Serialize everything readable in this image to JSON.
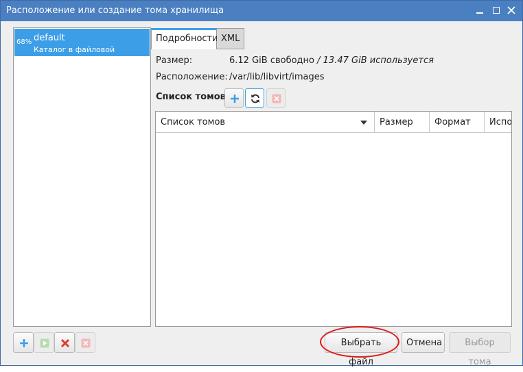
{
  "window": {
    "title": "Расположение или создание тома хранилища"
  },
  "pools": [
    {
      "percent": "68%",
      "name": "default",
      "description": "Каталог в файловой системе"
    }
  ],
  "tabs": [
    {
      "label": "Подробности",
      "active": true
    },
    {
      "label": "XML",
      "active": false
    }
  ],
  "details": {
    "size_label": "Размер:",
    "free": "6.12 GiB свободно",
    "separator": " / ",
    "used": "13.47 GiB используется",
    "location_label": "Расположение:",
    "location": "/var/lib/libvirt/images"
  },
  "volumes": {
    "header": "Список томов",
    "columns": [
      "Список томов",
      "Размер",
      "Формат",
      "Использовано"
    ],
    "rows": []
  },
  "buttons": {
    "browse_local": "Выбрать файл",
    "cancel": "Отмена",
    "choose_volume": "Выбор тома"
  },
  "icons": {
    "add": "plus-icon",
    "refresh": "refresh-icon",
    "delete": "delete-icon",
    "start": "play-icon",
    "stop": "stop-icon"
  },
  "colors": {
    "accent": "#3d9ee8",
    "titlebar": "#4a7fc1",
    "danger": "#e03a2e"
  }
}
